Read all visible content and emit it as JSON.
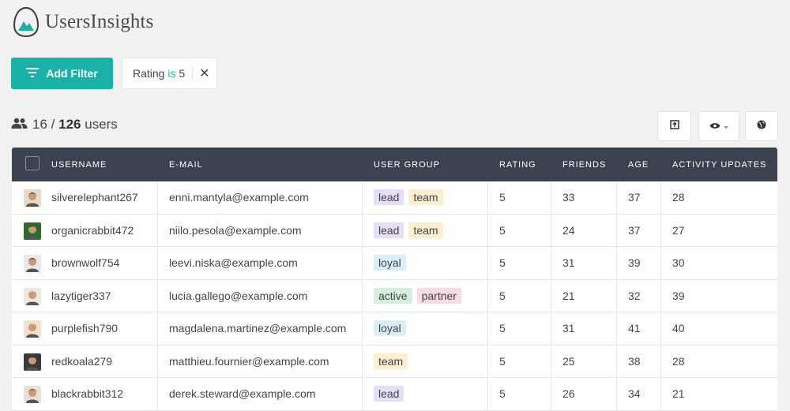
{
  "app": {
    "brand": "UsersInsights"
  },
  "filters": {
    "add_label": "Add Filter",
    "active": {
      "field": "Rating",
      "operator": "is",
      "value": "5"
    }
  },
  "summary": {
    "shown": "16",
    "separator": "/",
    "total": "126",
    "unit": "users"
  },
  "toolbar": {
    "export_icon": "export-icon",
    "columns_icon": "eye-icon",
    "map_icon": "globe-icon"
  },
  "colors": {
    "accent": "#1ab2a8",
    "header_bg": "#3b4350",
    "tag_lead": "#e6ddf6",
    "tag_team": "#fbefcf",
    "tag_loyal": "#d9eef8",
    "tag_active": "#d6eedc",
    "tag_partner": "#f9dbe6"
  },
  "table": {
    "columns": [
      "USERNAME",
      "E-MAIL",
      "USER GROUP",
      "RATING",
      "FRIENDS",
      "AGE",
      "ACTIVITY UPDATES"
    ],
    "rows": [
      {
        "username": "silverelephant267",
        "email": "enni.mantyla@example.com",
        "groups": [
          "lead",
          "team"
        ],
        "rating": "5",
        "friends": "33",
        "age": "37",
        "activity": "28"
      },
      {
        "username": "organicrabbit472",
        "email": "niilo.pesola@example.com",
        "groups": [
          "lead",
          "team"
        ],
        "rating": "5",
        "friends": "24",
        "age": "37",
        "activity": "27"
      },
      {
        "username": "brownwolf754",
        "email": "leevi.niska@example.com",
        "groups": [
          "loyal"
        ],
        "rating": "5",
        "friends": "31",
        "age": "39",
        "activity": "30"
      },
      {
        "username": "lazytiger337",
        "email": "lucia.gallego@example.com",
        "groups": [
          "active",
          "partner"
        ],
        "rating": "5",
        "friends": "21",
        "age": "32",
        "activity": "39"
      },
      {
        "username": "purplefish790",
        "email": "magdalena.martinez@example.com",
        "groups": [
          "loyal"
        ],
        "rating": "5",
        "friends": "31",
        "age": "41",
        "activity": "40"
      },
      {
        "username": "redkoala279",
        "email": "matthieu.fournier@example.com",
        "groups": [
          "team"
        ],
        "rating": "5",
        "friends": "25",
        "age": "38",
        "activity": "28"
      },
      {
        "username": "blackrabbit312",
        "email": "derek.steward@example.com",
        "groups": [
          "lead"
        ],
        "rating": "5",
        "friends": "26",
        "age": "34",
        "activity": "21"
      }
    ]
  }
}
